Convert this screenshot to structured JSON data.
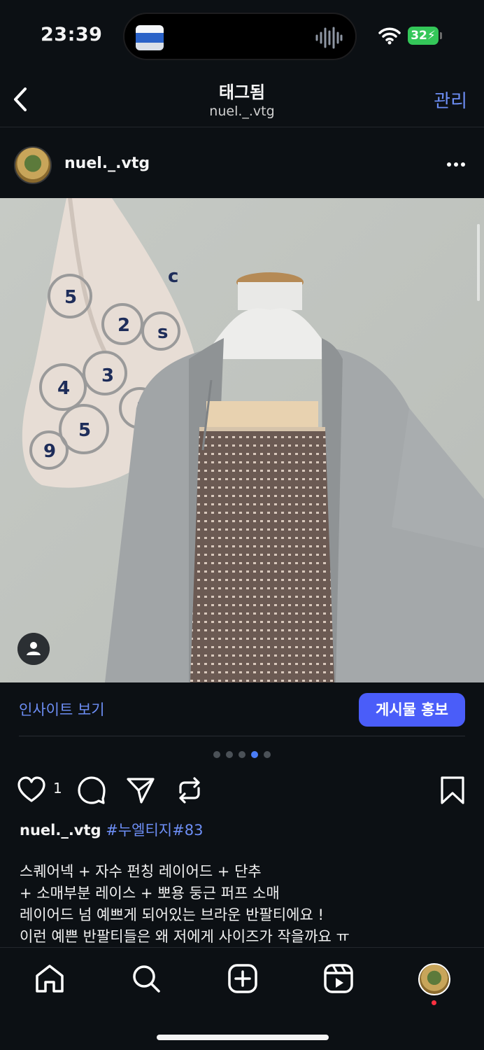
{
  "status_bar": {
    "time": "23:39",
    "battery": "32"
  },
  "header": {
    "title": "태그됨",
    "subtitle": "nuel._.vtg",
    "manage_label": "관리"
  },
  "post": {
    "username": "nuel._.vtg",
    "insights_label": "인사이트 보기",
    "promote_label": "게시물 홍보",
    "carousel": {
      "count": 5,
      "active_index": 3
    },
    "like_count": "1",
    "caption": {
      "username": "nuel._.vtg",
      "hashtags": "#누엘티지#83",
      "lines": [
        "스퀘어넥 + 자수 펀칭 레이어드 + 단추",
        "+ 소매부분 레이스 + 뽀용 둥근 퍼프 소매",
        "레이어드 넘 예쁘게 되어있는 브라운 반팔티에요 !",
        "이런 예쁜 반팔티들은 왜 저에게 사이즈가 작을까요 ㅠ"
      ]
    }
  },
  "colors": {
    "background": "#0c1014",
    "accent_link": "#6d8ef5",
    "promote_button": "#4a5df9",
    "battery": "#34c759",
    "active_dot": "#4a7df7",
    "notification_dot": "#ff3040"
  },
  "icons": {
    "back": "chevron-left-icon",
    "more": "more-dots-icon",
    "like": "heart-icon",
    "comment": "comment-icon",
    "share": "send-icon",
    "repost": "repost-icon",
    "save": "bookmark-icon",
    "tag": "person-tag-icon",
    "nav": [
      "home-icon",
      "search-icon",
      "create-icon",
      "reels-icon",
      "profile-avatar"
    ]
  }
}
